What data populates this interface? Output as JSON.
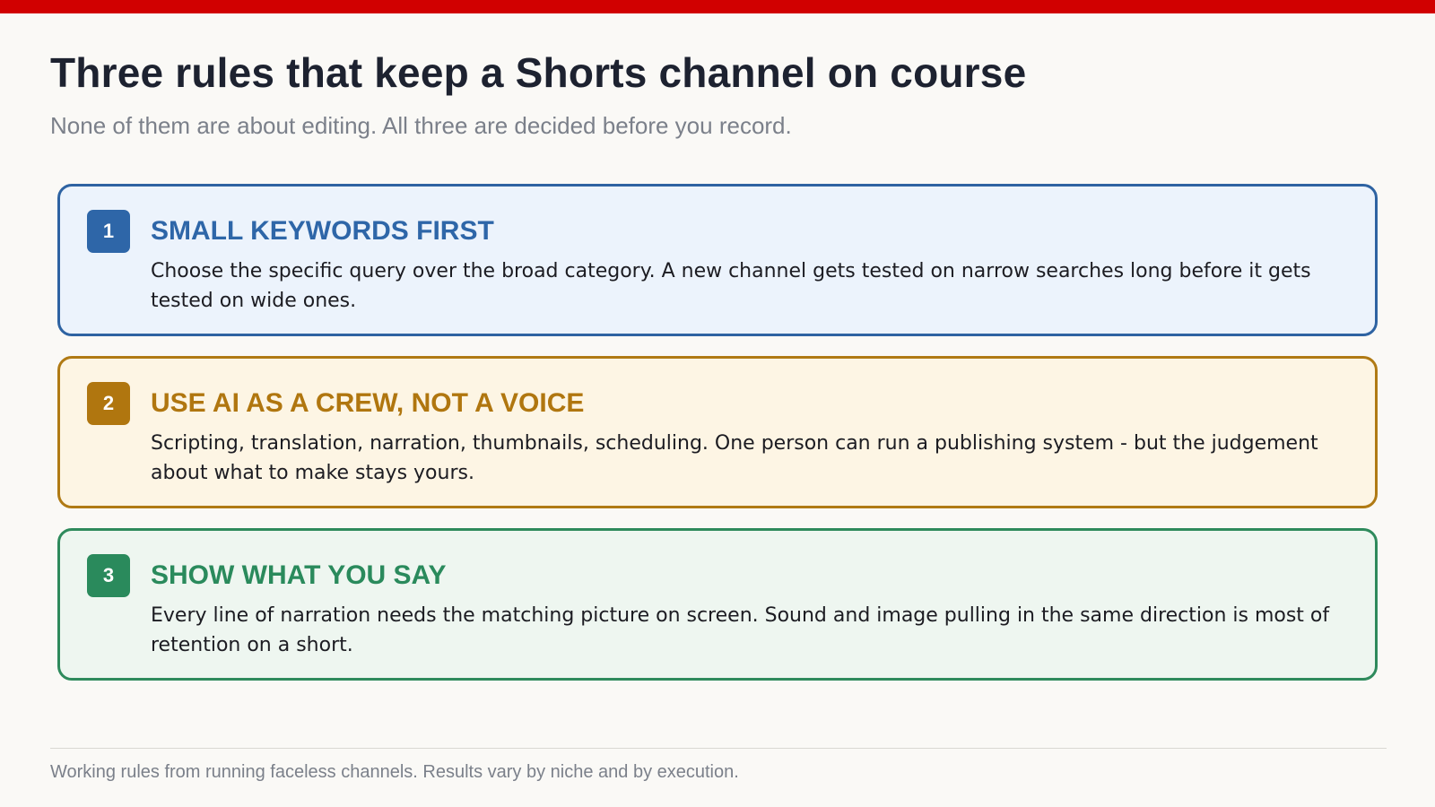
{
  "title": "Three rules that keep a Shorts channel on course",
  "subtitle": "None of them are about editing. All three are decided before you record.",
  "rules": [
    {
      "number": "1",
      "heading": "SMALL KEYWORDS FIRST",
      "body": "Choose the specific query over the broad category. A new channel gets tested on narrow searches long before it gets tested on wide ones.",
      "color": "#2e66a8"
    },
    {
      "number": "2",
      "heading": "USE AI AS A CREW, NOT A VOICE",
      "body": "Scripting, translation, narration, thumbnails, scheduling. One person can run a publishing system - but the judgement about what to make stays yours.",
      "color": "#b0760f"
    },
    {
      "number": "3",
      "heading": "SHOW WHAT YOU SAY",
      "body": "Every line of narration needs the matching picture on screen. Sound and image pulling in the same direction is most of retention on a short.",
      "color": "#2a8a5c"
    }
  ],
  "footer": "Working rules from running faceless channels. Results vary by niche and by execution.",
  "accent_color": "#d10000"
}
